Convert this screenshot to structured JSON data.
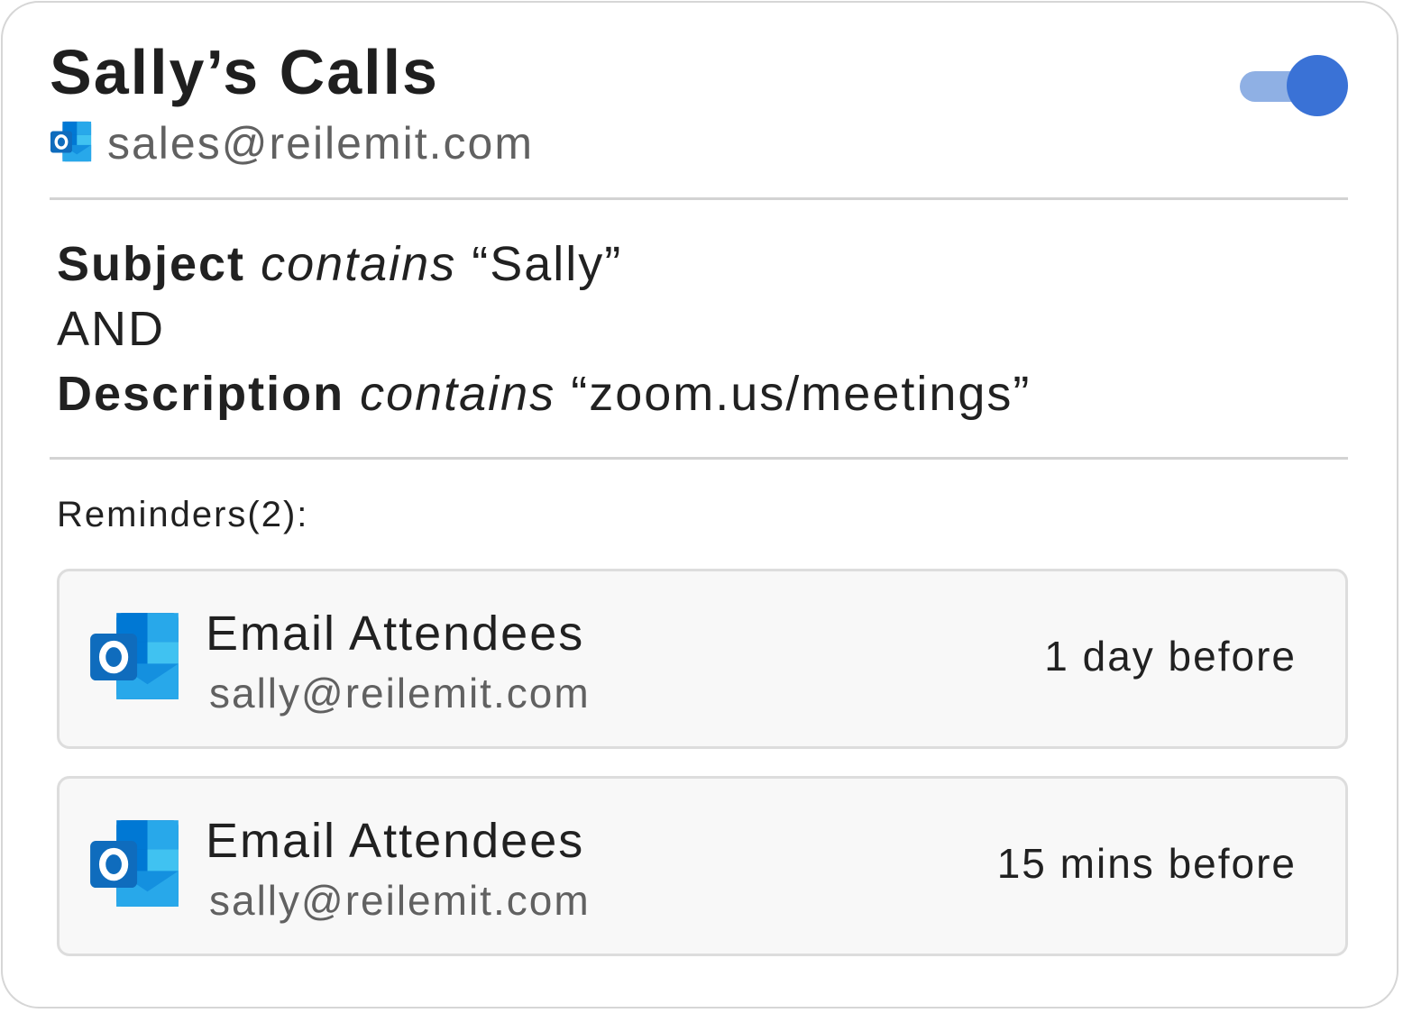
{
  "rule": {
    "title": "Sally’s Calls",
    "account_email": "sales@reilemit.com",
    "account_icon": "outlook-icon",
    "enabled": true,
    "colors": {
      "toggle_track": "#8fb0e4",
      "toggle_thumb": "#3a72d6"
    }
  },
  "conditions": [
    {
      "field": "Subject",
      "operator": "contains",
      "value": "“Sally”"
    },
    {
      "connector": "AND"
    },
    {
      "field": "Description",
      "operator": "contains",
      "value": "“zoom.us/meetings”"
    }
  ],
  "reminders": {
    "label": "Reminders(2):",
    "items": [
      {
        "icon": "outlook-icon",
        "action": "Email Attendees",
        "email": "sally@reilemit.com",
        "timing": "1 day before"
      },
      {
        "icon": "outlook-icon",
        "action": "Email Attendees",
        "email": "sally@reilemit.com",
        "timing": "15 mins before"
      }
    ]
  }
}
